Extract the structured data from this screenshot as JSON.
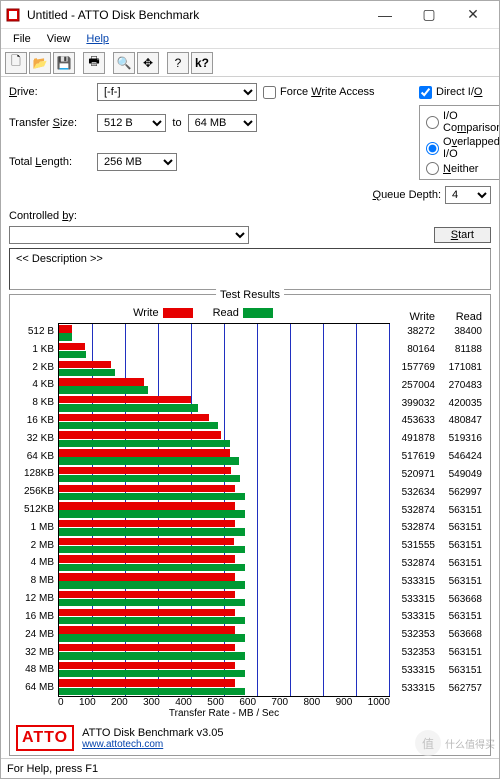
{
  "title": "Untitled - ATTO Disk Benchmark",
  "menu": {
    "file": "File",
    "view": "View",
    "help": "Help"
  },
  "toolbar_icons": [
    "new",
    "open",
    "save",
    "print",
    "preview",
    "move",
    "help",
    "about"
  ],
  "form": {
    "drive_label": "Drive:",
    "drive_value": "[-f-]",
    "transfer_label": "Transfer Size:",
    "transfer_from": "512 B",
    "transfer_mid": "to",
    "transfer_to": "64 MB",
    "length_label": "Total Length:",
    "length_value": "256 MB",
    "force_write": "Force Write Access",
    "direct_io": "Direct I/O",
    "io_comparison": "I/O Comparison",
    "overlapped_io": "Overlapped I/O",
    "neither": "Neither",
    "queue_label": "Queue Depth:",
    "queue_value": "4",
    "controlled_label": "Controlled by:",
    "start": "Start",
    "description": "<< Description >>"
  },
  "results": {
    "legend_title": "Test Results",
    "write_label": "Write",
    "read_label": "Read",
    "xaxis_label": "Transfer Rate - MB / Sec",
    "xticks": [
      "0",
      "100",
      "200",
      "300",
      "400",
      "500",
      "600",
      "700",
      "800",
      "900",
      "1000"
    ]
  },
  "chart_data": {
    "type": "bar",
    "xlabel": "Transfer Rate - MB / Sec",
    "ylabel": "",
    "xlim": [
      0,
      1000
    ],
    "categories": [
      "512 B",
      "1 KB",
      "2 KB",
      "4 KB",
      "8 KB",
      "16 KB",
      "32 KB",
      "64 KB",
      "128KB",
      "256KB",
      "512KB",
      "1 MB",
      "2 MB",
      "4 MB",
      "8 MB",
      "12 MB",
      "16 MB",
      "24 MB",
      "32 MB",
      "48 MB",
      "64 MB"
    ],
    "series": [
      {
        "name": "Write",
        "color": "#e60000",
        "values": [
          38272,
          80164,
          157769,
          257004,
          399032,
          453633,
          491878,
          517619,
          520971,
          532634,
          532874,
          532874,
          531555,
          532874,
          533315,
          533315,
          533315,
          532353,
          532353,
          533315,
          533315
        ]
      },
      {
        "name": "Read",
        "color": "#009933",
        "values": [
          38400,
          81188,
          171081,
          270483,
          420035,
          480847,
          519316,
          546424,
          549049,
          562997,
          563151,
          563151,
          563151,
          563151,
          563151,
          563668,
          563151,
          563668,
          563151,
          563151,
          562757
        ]
      }
    ]
  },
  "footer": {
    "brand": "ATTO",
    "product": "ATTO Disk Benchmark v3.05",
    "url": "www.attotech.com"
  },
  "status": "For Help, press F1",
  "watermark": "什么值得买"
}
